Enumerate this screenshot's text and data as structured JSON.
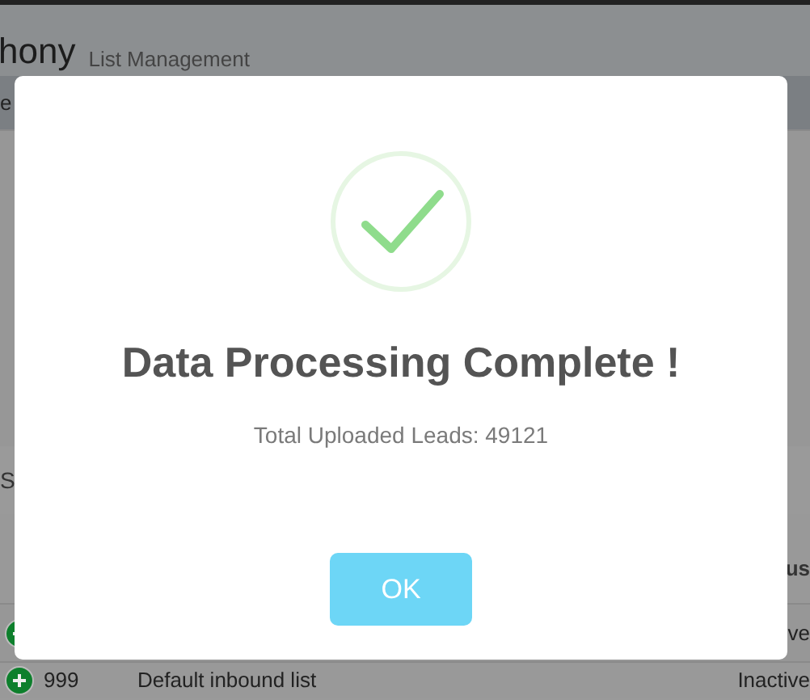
{
  "app": {
    "title": "hony",
    "subtitle": "List Management"
  },
  "background": {
    "toolbar_fragment": "e",
    "section_fragment": "S",
    "column_fragment": "us",
    "rows": [
      {
        "status": "ve"
      },
      {
        "id": "999",
        "name": "Default inbound list",
        "status": "Inactive"
      }
    ]
  },
  "dialog": {
    "title": "Data Processing Complete !",
    "message": "Total Uploaded Leads: 49121",
    "button": "OK"
  }
}
